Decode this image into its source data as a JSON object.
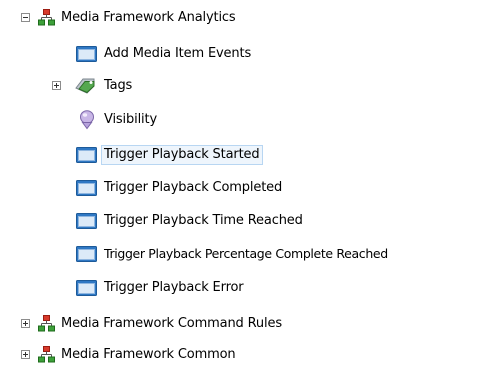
{
  "tree": {
    "root": {
      "label": "Media Framework Analytics",
      "expanded": true,
      "icon": "rules-hierarchy-icon",
      "children": [
        {
          "label": "Add Media Item Events",
          "icon": "window-icon"
        },
        {
          "label": "Tags",
          "icon": "tag-icon",
          "expanded": false
        },
        {
          "label": "Visibility",
          "icon": "shield-icon"
        },
        {
          "label": "Trigger Playback Started",
          "icon": "window-icon",
          "selected": true
        },
        {
          "label": "Trigger Playback Completed",
          "icon": "window-icon"
        },
        {
          "label": "Trigger Playback Time Reached",
          "icon": "window-icon"
        },
        {
          "label": "Trigger Playback Percentage Complete Reached",
          "icon": "window-icon"
        },
        {
          "label": "Trigger Playback Error",
          "icon": "window-icon"
        }
      ]
    },
    "siblings": [
      {
        "label": "Media Framework Command Rules",
        "icon": "rules-hierarchy-icon",
        "expanded": false
      },
      {
        "label": "Media Framework Common",
        "icon": "rules-hierarchy-icon",
        "expanded": false
      }
    ]
  },
  "colors": {
    "selection_bg": "#eef5fc",
    "selection_border": "#b8d6f2",
    "window_icon_blue": "#2f78c4",
    "hierarchy_icon_red": "#d83a2b",
    "hierarchy_icon_green": "#3da03a"
  }
}
